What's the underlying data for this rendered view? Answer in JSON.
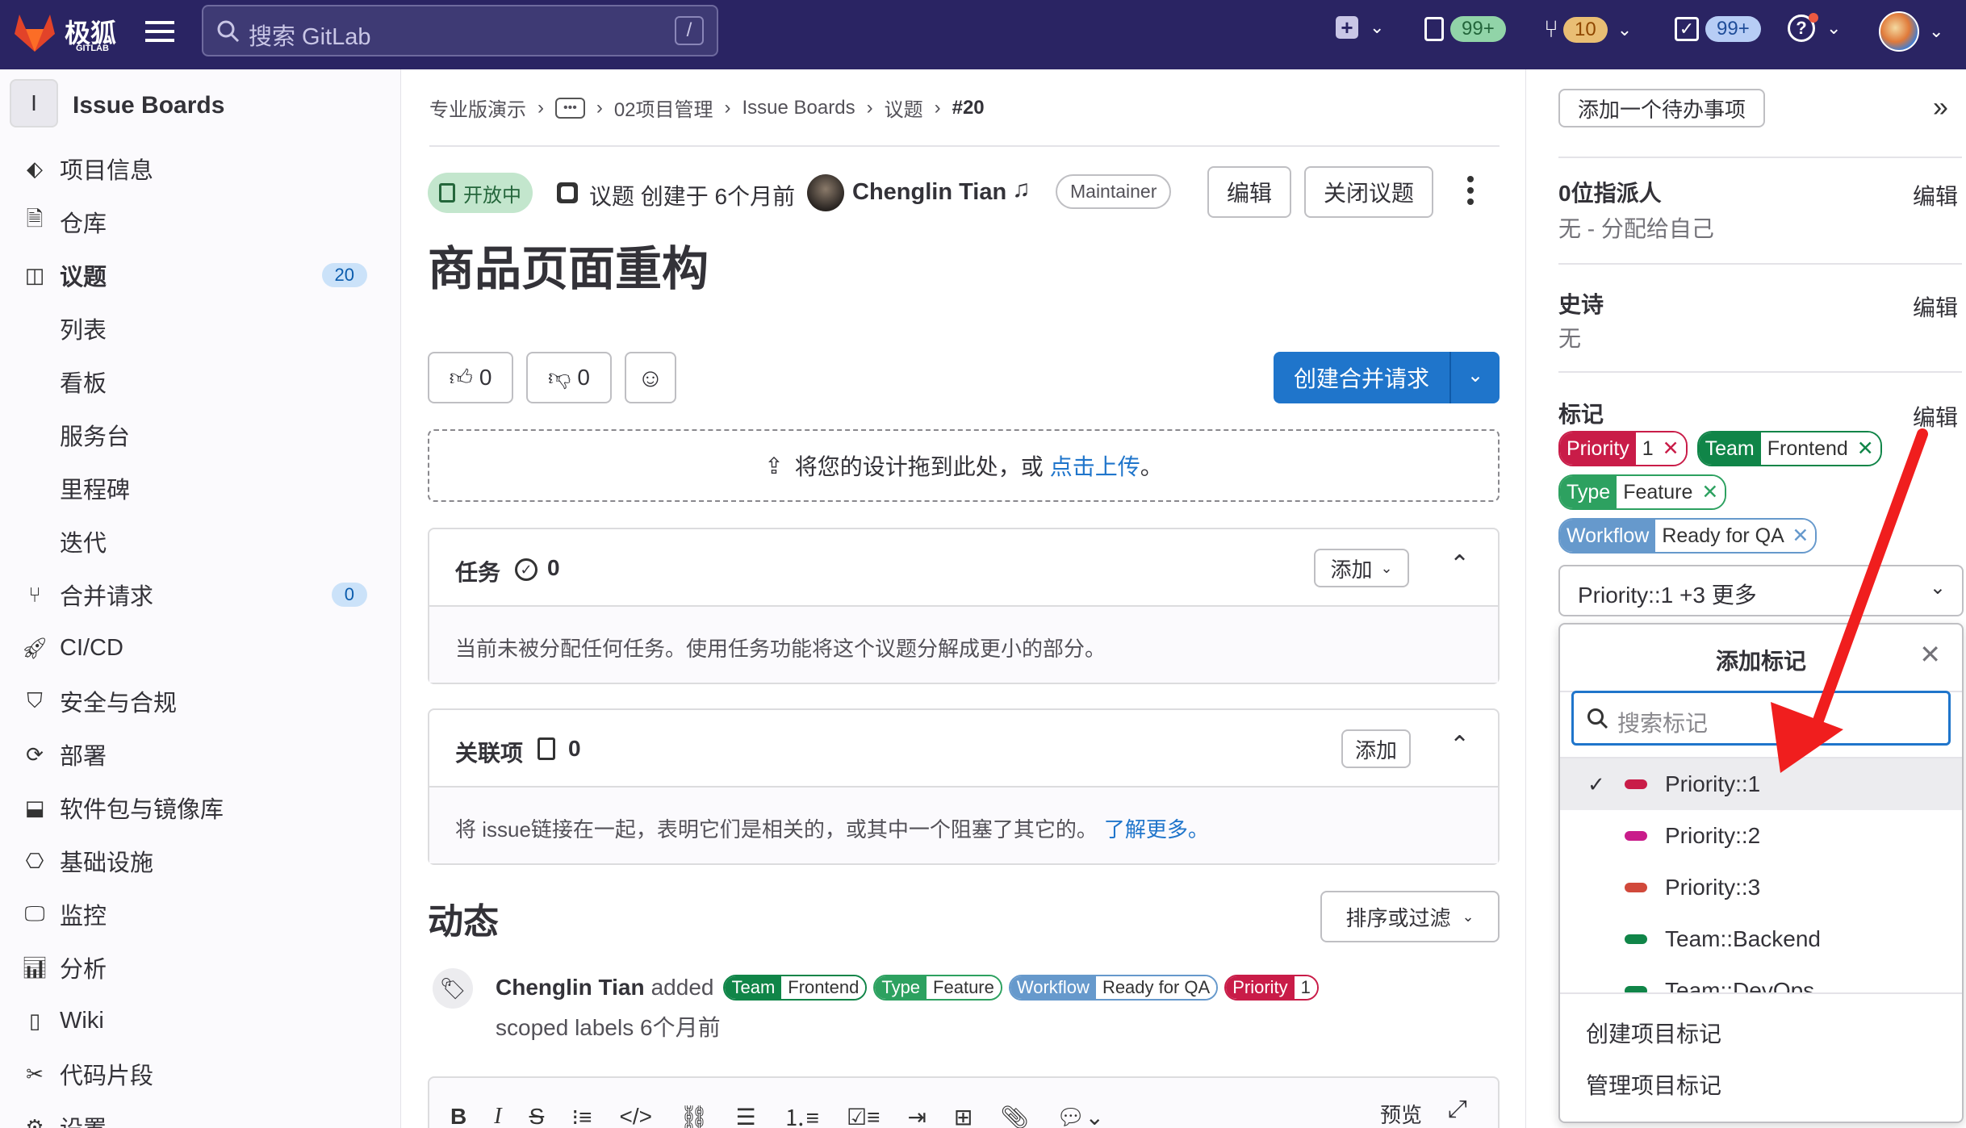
{
  "topbar": {
    "brand": "极狐",
    "brand_sub": "GITLAB",
    "search_placeholder": "搜索 GitLab",
    "search_shortcut": "/",
    "issues_count": "99+",
    "mr_count": "10",
    "todo_count": "99+"
  },
  "sidebar": {
    "project_initial": "I",
    "project_name": "Issue Boards",
    "items": [
      {
        "label": "项目信息",
        "icon": "info-icon"
      },
      {
        "label": "仓库",
        "icon": "repo-icon"
      },
      {
        "label": "议题",
        "icon": "issues-icon",
        "count": "20"
      },
      {
        "label": "列表"
      },
      {
        "label": "看板"
      },
      {
        "label": "服务台"
      },
      {
        "label": "里程碑"
      },
      {
        "label": "迭代"
      },
      {
        "label": "合并请求",
        "icon": "merge-request-icon",
        "count": "0"
      },
      {
        "label": "CI/CD",
        "icon": "rocket-icon"
      },
      {
        "label": "安全与合规",
        "icon": "shield-icon"
      },
      {
        "label": "部署",
        "icon": "deploy-icon"
      },
      {
        "label": "软件包与镜像库",
        "icon": "package-icon"
      },
      {
        "label": "基础设施",
        "icon": "infra-icon"
      },
      {
        "label": "监控",
        "icon": "monitor-icon"
      },
      {
        "label": "分析",
        "icon": "chart-icon"
      },
      {
        "label": "Wiki",
        "icon": "book-icon"
      },
      {
        "label": "代码片段",
        "icon": "scissors-icon"
      },
      {
        "label": "设置",
        "icon": "gear-icon"
      }
    ]
  },
  "breadcrumb": [
    "专业版演示",
    "•••",
    "02项目管理",
    "Issue Boards",
    "议题",
    "#20"
  ],
  "issue": {
    "status": "开放中",
    "meta_prefix": "议题 创建于 6个月前",
    "author": "Chenglin Tian",
    "author_role": "Maintainer",
    "edit_label": "编辑",
    "close_label": "关闭议题",
    "title": "商品页面重构",
    "thumbs_up": "0",
    "thumbs_down": "0",
    "create_mr_label": "创建合并请求",
    "upload_text": "将您的设计拖到此处，或",
    "upload_link": "点击上传",
    "upload_suffix": "。"
  },
  "tasks": {
    "title": "任务",
    "count": "0",
    "add_label": "添加",
    "empty_text": "当前未被分配任何任务。使用任务功能将这个议题分解成更小的部分。"
  },
  "linked": {
    "title": "关联项",
    "count": "0",
    "add_label": "添加",
    "text": "将 issue链接在一起，表明它们是相关的，或其中一个阻塞了其它的。",
    "link": "了解更多。"
  },
  "activity": {
    "title": "动态",
    "sort_label": "排序或过滤",
    "author": "Chenglin Tian",
    "action": "added",
    "suffix": "scoped labels 6个月前",
    "preview_label": "预览"
  },
  "right": {
    "todo_button": "添加一个待办事项",
    "assignee_title": "0位指派人",
    "assignee_value": "无 - 分配给自己",
    "epic_title": "史诗",
    "epic_value": "无",
    "labels_title": "标记",
    "edit_label": "编辑",
    "labels": [
      {
        "key": "Priority",
        "value": "1",
        "color": "#c91c48"
      },
      {
        "key": "Team",
        "value": "Frontend",
        "color": "#108548"
      },
      {
        "key": "Type",
        "value": "Feature",
        "color": "#2da160"
      },
      {
        "key": "Workflow",
        "value": "Ready for QA",
        "color": "#6699cc"
      }
    ],
    "select_value": "Priority::1 +3 更多",
    "dropdown_title": "添加标记",
    "dropdown_search_placeholder": "搜索标记",
    "options": [
      {
        "label": "Priority::1",
        "color": "#c91c48",
        "checked": true
      },
      {
        "label": "Priority::2",
        "color": "#c91c8a",
        "checked": false
      },
      {
        "label": "Priority::3",
        "color": "#d1493b",
        "checked": false
      },
      {
        "label": "Team::Backend",
        "color": "#108548",
        "checked": false
      },
      {
        "label": "Team::DevOps",
        "color": "#108548",
        "checked": false
      }
    ],
    "create_label": "创建项目标记",
    "manage_label": "管理项目标记"
  }
}
